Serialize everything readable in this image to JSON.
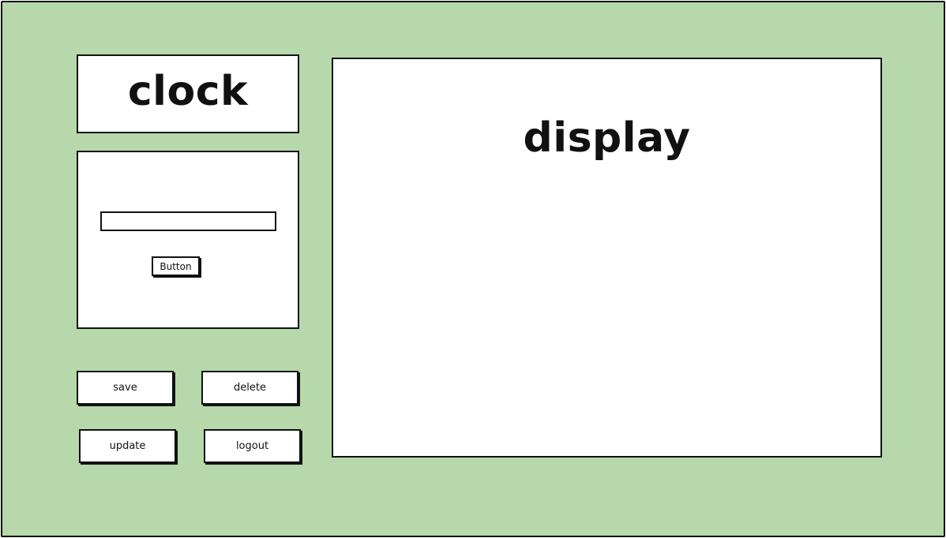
{
  "app": {
    "background_color": "#b7d8aa"
  },
  "clock_panel": {
    "title": "clock"
  },
  "form_panel": {
    "input_value": "",
    "button_label": "Button"
  },
  "actions": {
    "save_label": "save",
    "delete_label": "delete",
    "update_label": "update",
    "logout_label": "logout"
  },
  "display_panel": {
    "title": "display"
  }
}
